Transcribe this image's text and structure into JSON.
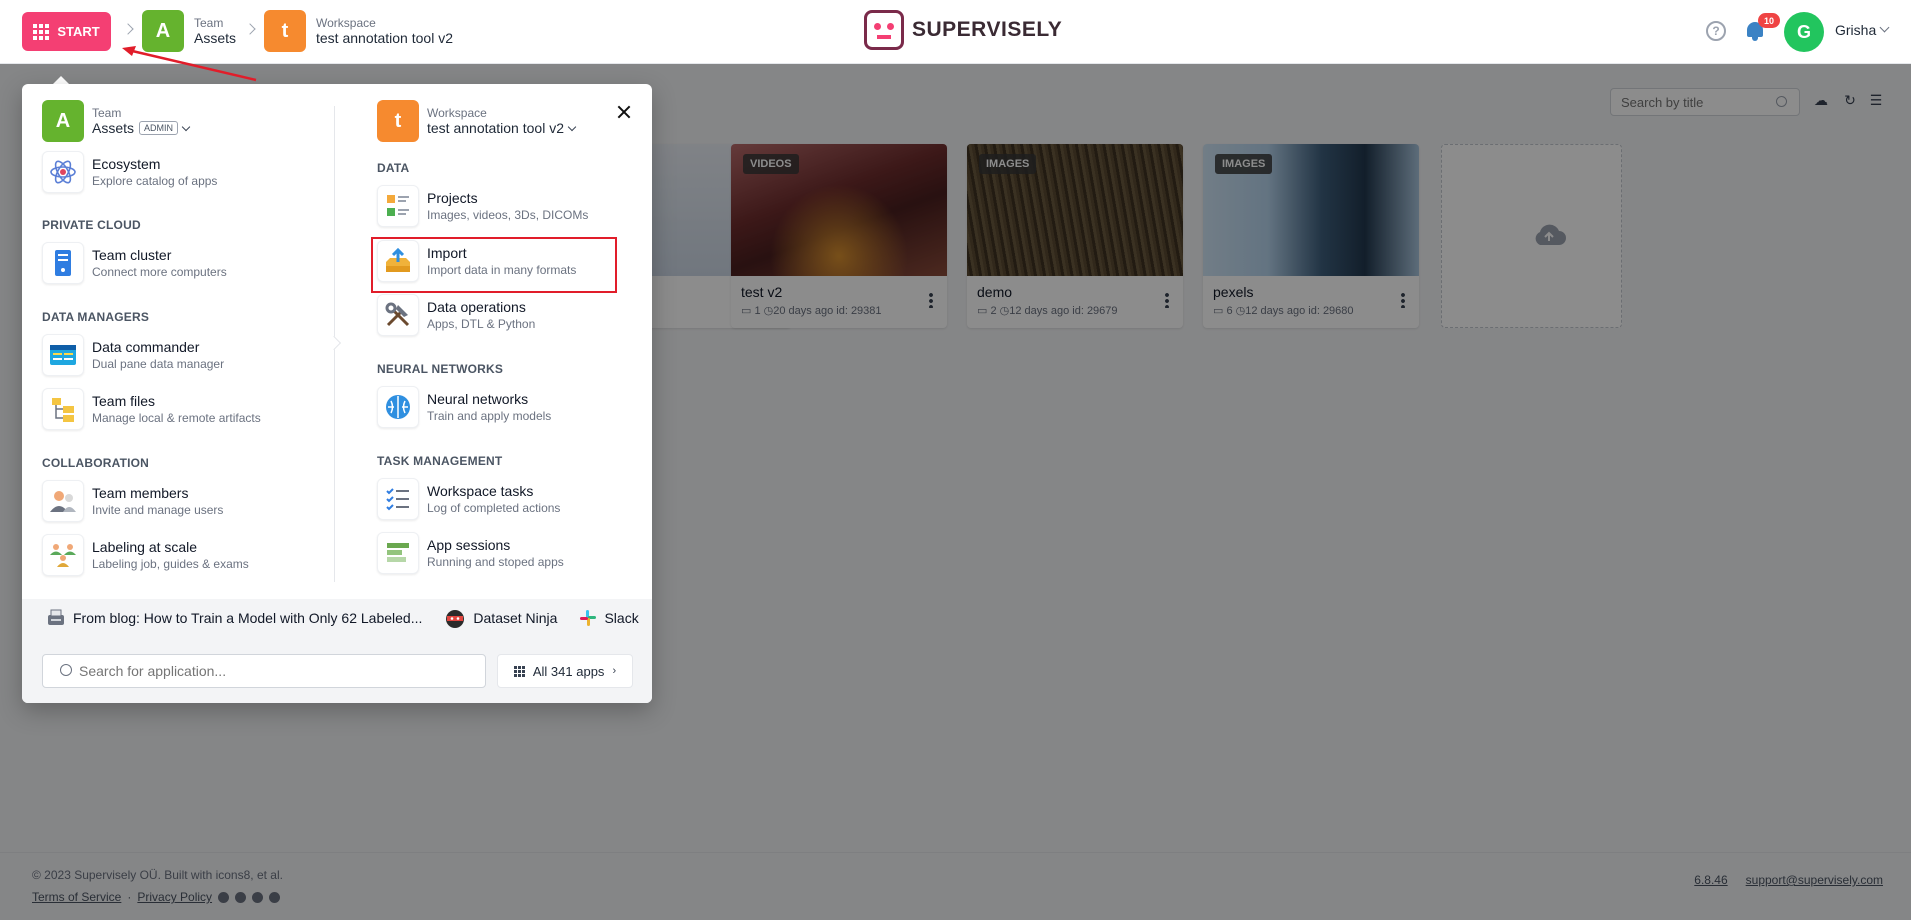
{
  "topbar": {
    "start_label": "START",
    "team": {
      "caption": "Team",
      "name": "Assets",
      "initial": "A"
    },
    "workspace": {
      "caption": "Workspace",
      "name": "test annotation tool v2",
      "initial": "t"
    },
    "logo_text": "SUPERVISELY",
    "notifications_count": "10",
    "user_initial": "G",
    "user_name": "Grisha"
  },
  "toolbar": {
    "search_placeholder": "Search by title"
  },
  "cards": [
    {
      "tag": "VIDEOS",
      "title": "test v2",
      "count": "1",
      "age": "20 days ago",
      "id": "id: 29381"
    },
    {
      "tag": "IMAGES",
      "title": "demo",
      "count": "2",
      "age": "12 days ago",
      "id": "id: 29679"
    },
    {
      "tag": "IMAGES",
      "title": "pexels",
      "count": "6",
      "age": "12 days ago",
      "id": "id: 29680"
    }
  ],
  "menu": {
    "left": {
      "team_caption": "Team",
      "team_name": "Assets",
      "team_initial": "A",
      "admin_badge": "ADMIN",
      "ecosystem": {
        "title": "Ecosystem",
        "sub": "Explore catalog of apps"
      },
      "private_cloud_label": "PRIVATE CLOUD",
      "team_cluster": {
        "title": "Team cluster",
        "sub": "Connect more computers"
      },
      "data_managers_label": "DATA MANAGERS",
      "data_commander": {
        "title": "Data commander",
        "sub": "Dual pane data manager"
      },
      "team_files": {
        "title": "Team files",
        "sub": "Manage local & remote artifacts"
      },
      "collaboration_label": "COLLABORATION",
      "team_members": {
        "title": "Team members",
        "sub": "Invite and manage users"
      },
      "labeling": {
        "title": "Labeling at scale",
        "sub": "Labeling job, guides & exams"
      }
    },
    "right": {
      "ws_caption": "Workspace",
      "ws_name": "test annotation tool v2",
      "ws_initial": "t",
      "data_label": "DATA",
      "projects": {
        "title": "Projects",
        "sub": "Images, videos, 3Ds, DICOMs"
      },
      "import": {
        "title": "Import",
        "sub": "Import data in many formats"
      },
      "data_ops": {
        "title": "Data operations",
        "sub": "Apps, DTL & Python"
      },
      "nn_label": "NEURAL NETWORKS",
      "neural_networks": {
        "title": "Neural networks",
        "sub": "Train and apply models"
      },
      "task_label": "TASK MANAGEMENT",
      "workspace_tasks": {
        "title": "Workspace tasks",
        "sub": "Log of completed actions"
      },
      "app_sessions": {
        "title": "App sessions",
        "sub": "Running and stoped apps"
      }
    },
    "bottom": {
      "blog_link": "From blog: How to Train a Model with Only 62 Labeled...",
      "dataset_ninja": "Dataset Ninja",
      "slack": "Slack",
      "app_search_placeholder": "Search for application...",
      "all_apps": "All 341 apps"
    }
  },
  "footer": {
    "copyright": "© 2023 Supervisely OÜ. Built with icons8, et al.",
    "terms": "Terms of Service",
    "privacy": "Privacy Policy",
    "version": "6.8.46",
    "support": "support@supervisely.com"
  },
  "colors": {
    "start": "#f43f73",
    "team": "#65b32e",
    "workspace": "#f68a2f",
    "highlight": "#e11d2a"
  }
}
